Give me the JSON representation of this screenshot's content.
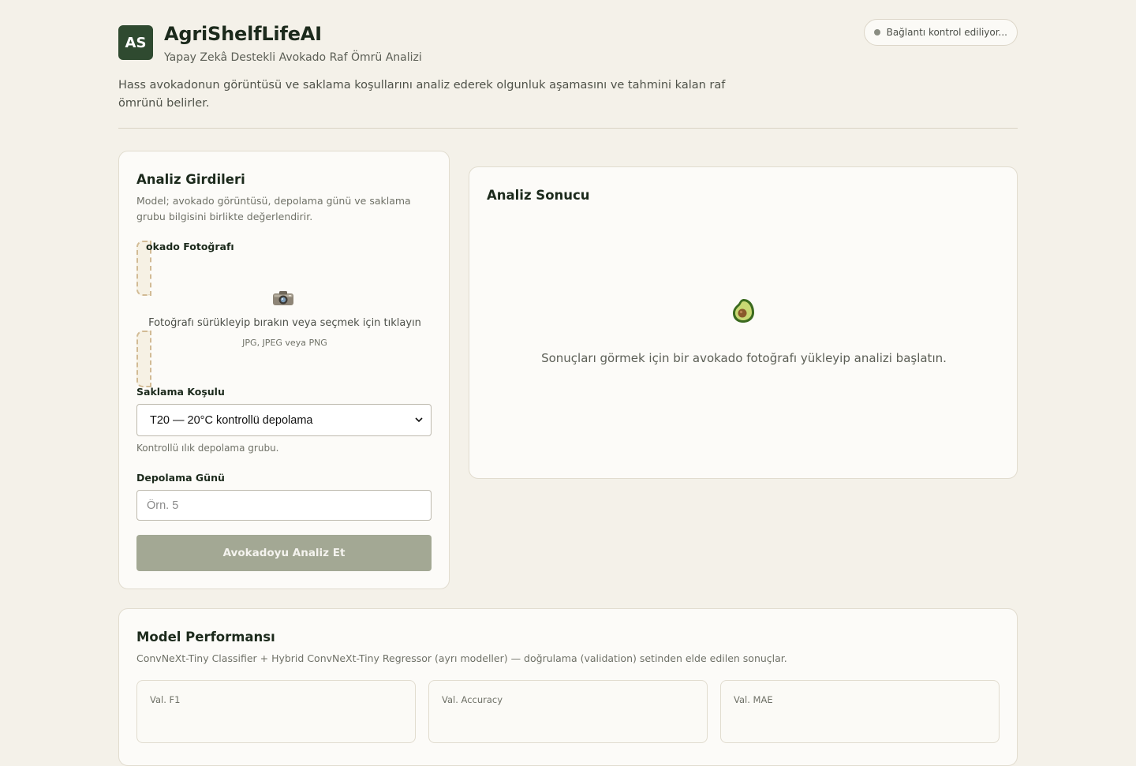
{
  "header": {
    "logo_text": "AS",
    "title": "AgriShelfLifeAI",
    "subtitle": "Yapay Zekâ Destekli Avokado Raf Ömrü Analizi",
    "status": "Bağlantı kontrol ediliyor...",
    "intro": "Hass avokadonun görüntüsü ve saklama koşullarını analiz ederek olgunluk aşamasını ve tahmini kalan raf ömrünü belirler."
  },
  "input_panel": {
    "title": "Analiz Girdileri",
    "description": "Model; avokado görüntüsü, depolama günü ve saklama grubu bilgisini birlikte değerlendirir.",
    "photo_label": "okado Fotoğrafı",
    "drop_text": "Fotoğrafı sürükleyip bırakın veya seçmek için tıklayın",
    "drop_formats": "JPG, JPEG veya PNG",
    "storage_label": "Saklama Koşulu",
    "storage_selected": "T20 — 20°C kontrollü depolama",
    "storage_hint": "Kontrollü ılık depolama grubu.",
    "day_label": "Depolama Günü",
    "day_placeholder": "Örn. 5",
    "analyze_button": "Avokadoyu Analiz Et"
  },
  "result_panel": {
    "title": "Analiz Sonucu",
    "empty_text": "Sonuçları görmek için bir avokado fotoğrafı yükleyip analizi başlatın."
  },
  "performance": {
    "title": "Model Performansı",
    "description": "ConvNeXt-Tiny Classifier + Hybrid ConvNeXt-Tiny Regressor (ayrı modeller) — doğrulama (validation) setinden elde edilen sonuçlar.",
    "metrics": [
      {
        "label": "Val. F1"
      },
      {
        "label": "Val. Accuracy"
      },
      {
        "label": "Val. MAE"
      }
    ]
  },
  "icons": {
    "camera": "camera-icon",
    "avocado": "avocado-icon",
    "status_dot": "status-dot-icon"
  },
  "colors": {
    "background": "#f4f1e9",
    "brand": "#2f4a30",
    "button_disabled": "#a3a894",
    "dash_border": "#d2bb95"
  }
}
